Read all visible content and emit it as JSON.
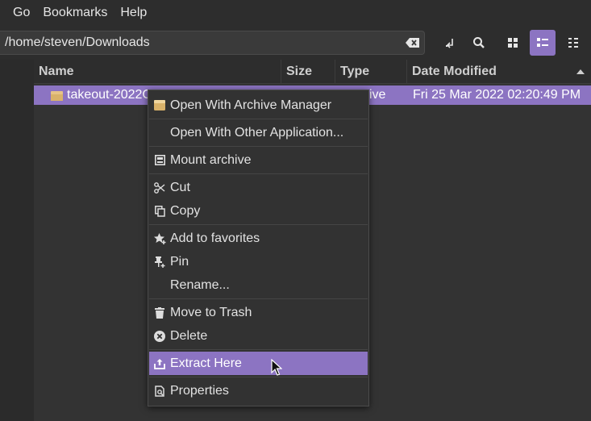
{
  "menubar": {
    "items": [
      "Go",
      "Bookmarks",
      "Help"
    ]
  },
  "toolbar": {
    "path": "/home/steven/Downloads",
    "buttons": [
      "toggle-location-icon",
      "search-icon",
      "icon-view-icon",
      "list-view-icon",
      "compact-view-icon"
    ]
  },
  "columns": {
    "name": "Name",
    "size": "Size",
    "type": "Type",
    "date": "Date Modified"
  },
  "file": {
    "name": "takeout-2022C",
    "size": "",
    "type": "ive",
    "date": "Fri 25 Mar 2022 02:20:49 PM"
  },
  "context_menu": {
    "items": [
      {
        "label": "Open With Archive Manager",
        "icon": "archive-manager-icon"
      },
      {
        "label": "Open With Other Application...",
        "icon": ""
      },
      {
        "label": "Mount archive",
        "icon": "mount-icon"
      },
      {
        "label": "Cut",
        "icon": "scissors-icon"
      },
      {
        "label": "Copy",
        "icon": "copy-icon"
      },
      {
        "label": "Add to favorites",
        "icon": "star-icon"
      },
      {
        "label": "Pin",
        "icon": "pin-icon"
      },
      {
        "label": "Rename...",
        "icon": ""
      },
      {
        "label": "Move to Trash",
        "icon": "trash-icon"
      },
      {
        "label": "Delete",
        "icon": "delete-icon"
      },
      {
        "label": "Extract Here",
        "icon": "extract-icon"
      },
      {
        "label": "Properties",
        "icon": "properties-icon"
      }
    ],
    "highlighted": "Extract Here"
  },
  "colors": {
    "accent": "#8c74c2",
    "background": "#2b2b2b",
    "menu": "#323232"
  }
}
